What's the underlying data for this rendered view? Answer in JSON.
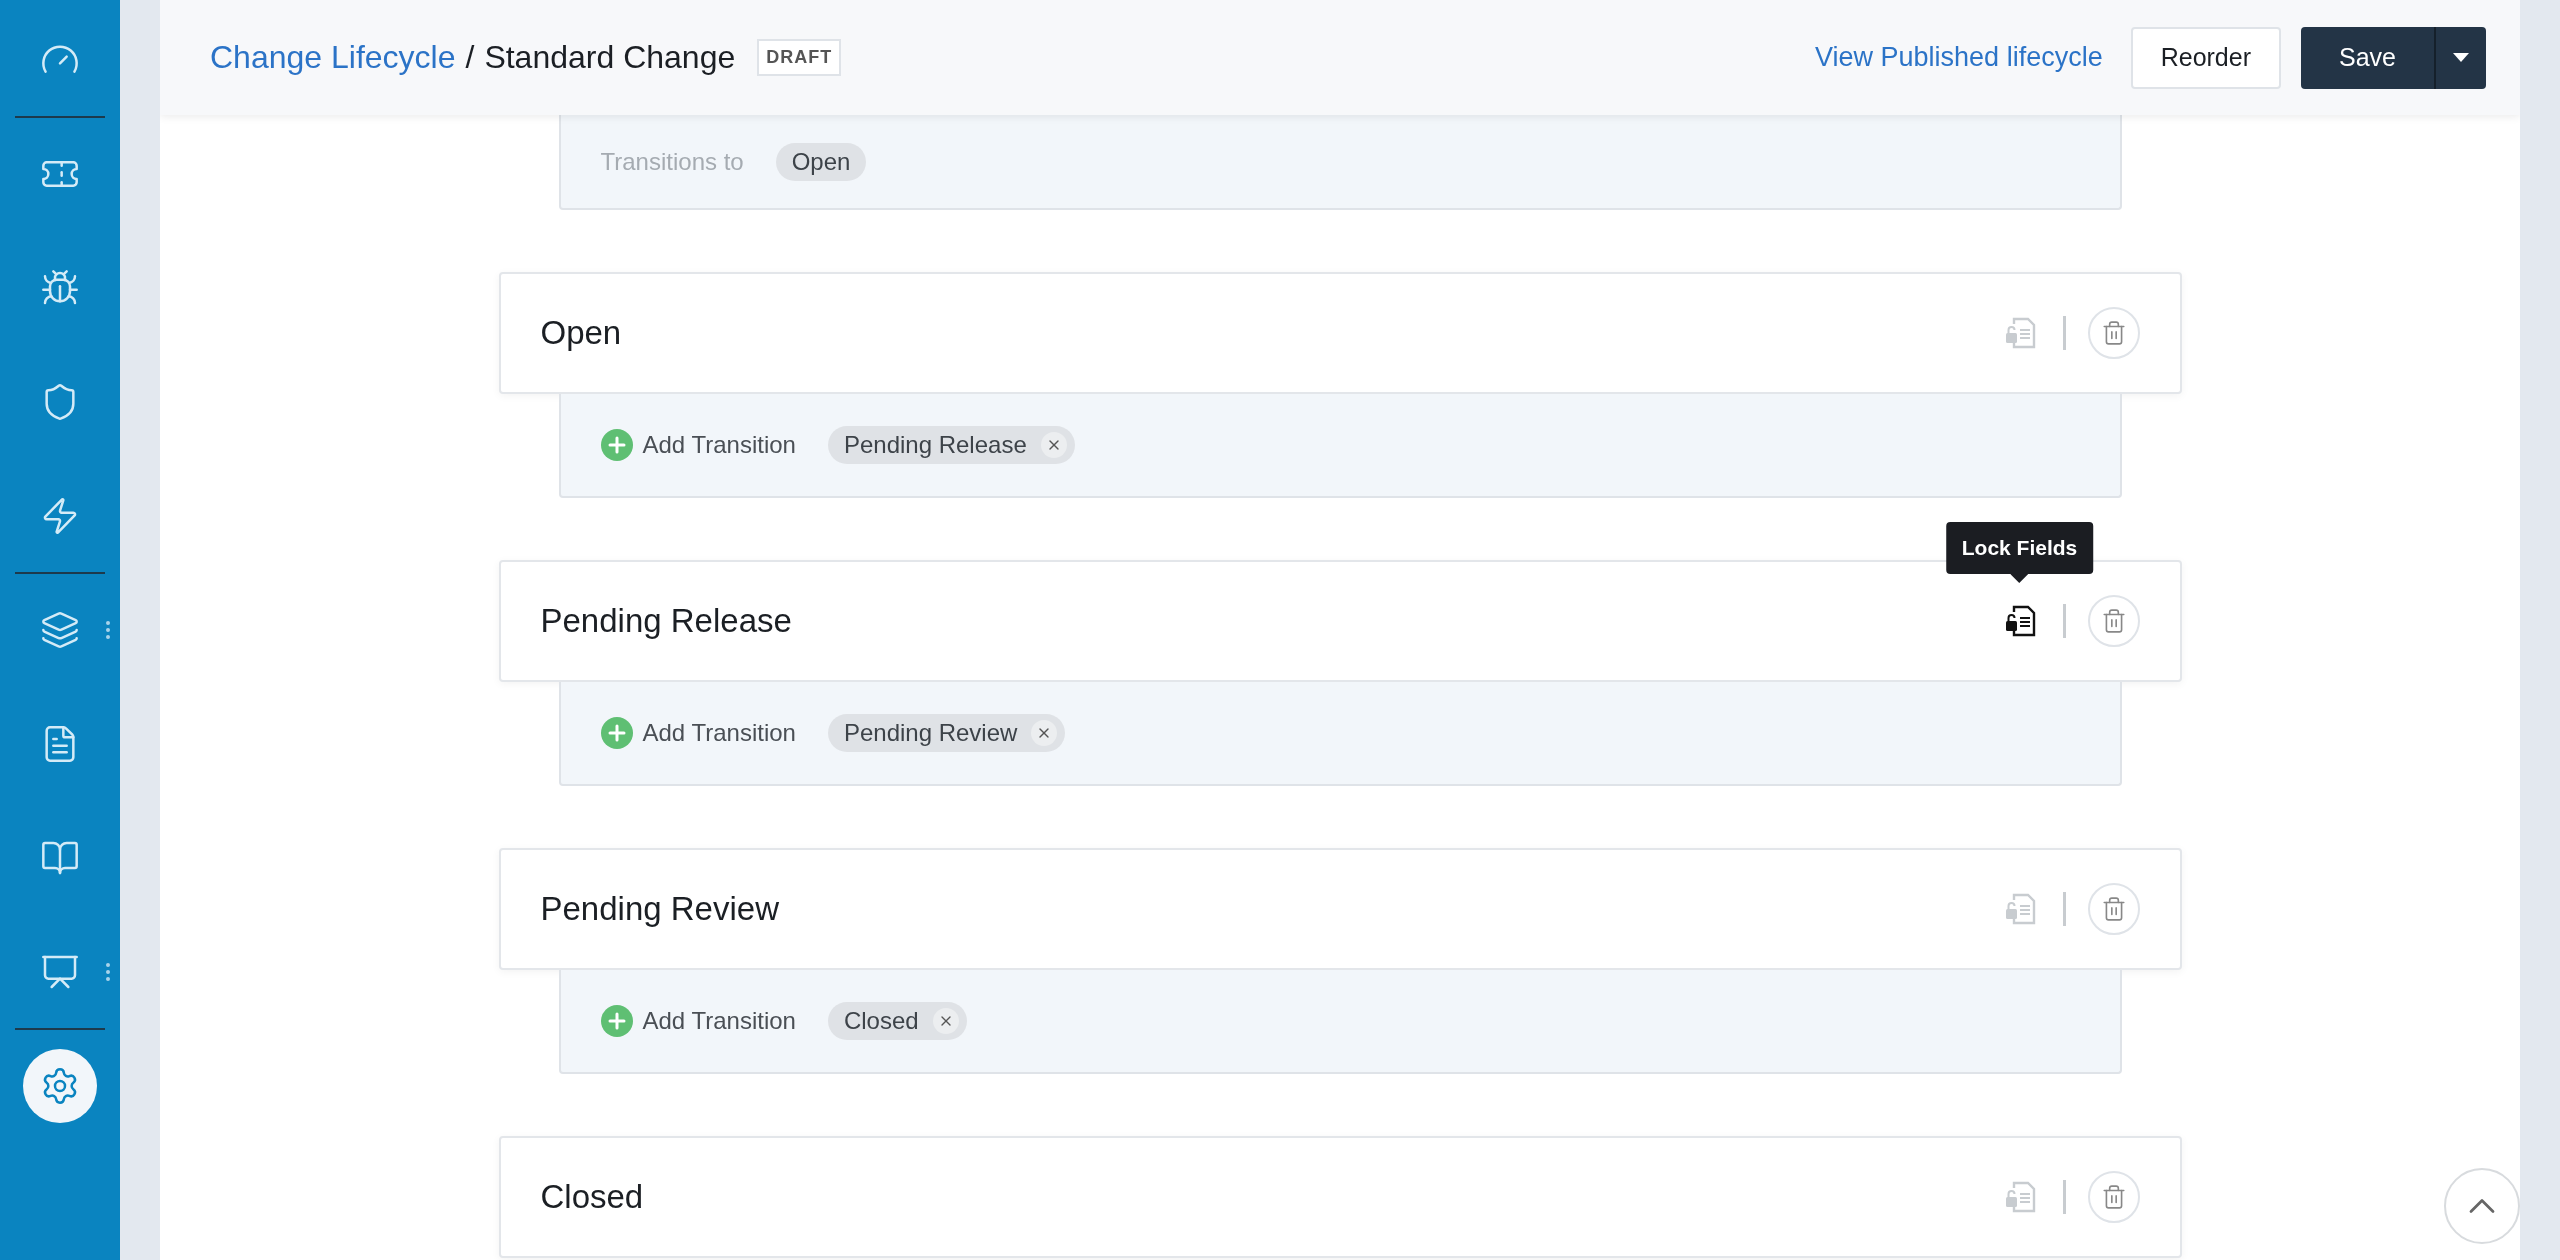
{
  "sidebar": {
    "groups": [
      [
        {
          "selected": false,
          "more_menu": false
        }
      ],
      [
        {
          "selected": false,
          "more_menu": false
        },
        {
          "selected": false,
          "more_menu": false
        },
        {
          "selected": false,
          "more_menu": false
        },
        {
          "selected": false,
          "more_menu": false
        }
      ],
      [
        {
          "selected": false,
          "more_menu": true
        },
        {
          "selected": false,
          "more_menu": false
        },
        {
          "selected": false,
          "more_menu": false
        },
        {
          "selected": false,
          "more_menu": true
        }
      ],
      [
        {
          "selected": true,
          "more_menu": false
        }
      ]
    ]
  },
  "header": {
    "breadcrumb_link": "Change Lifecycle",
    "separator": "/",
    "title": "Standard Change",
    "badge": "DRAFT",
    "view_link": "View Published lifecycle",
    "reorder_button": "Reorder",
    "save_button": "Save"
  },
  "top_panel": {
    "label": "Transitions to",
    "tags": [
      {
        "label": "Open",
        "removable": false
      }
    ]
  },
  "states": [
    {
      "name": "Open",
      "lock_highlighted": false,
      "panel": {
        "add_label": "Add Transition",
        "tags": [
          {
            "label": "Pending Release",
            "removable": true
          }
        ]
      }
    },
    {
      "name": "Pending Release",
      "lock_highlighted": true,
      "tooltip": "Lock Fields",
      "panel": {
        "add_label": "Add Transition",
        "tags": [
          {
            "label": "Pending Review",
            "removable": true
          }
        ]
      }
    },
    {
      "name": "Pending Review",
      "lock_highlighted": false,
      "panel": {
        "add_label": "Add Transition",
        "tags": [
          {
            "label": "Closed",
            "removable": true
          }
        ]
      }
    },
    {
      "name": "Closed",
      "lock_highlighted": false
    }
  ]
}
